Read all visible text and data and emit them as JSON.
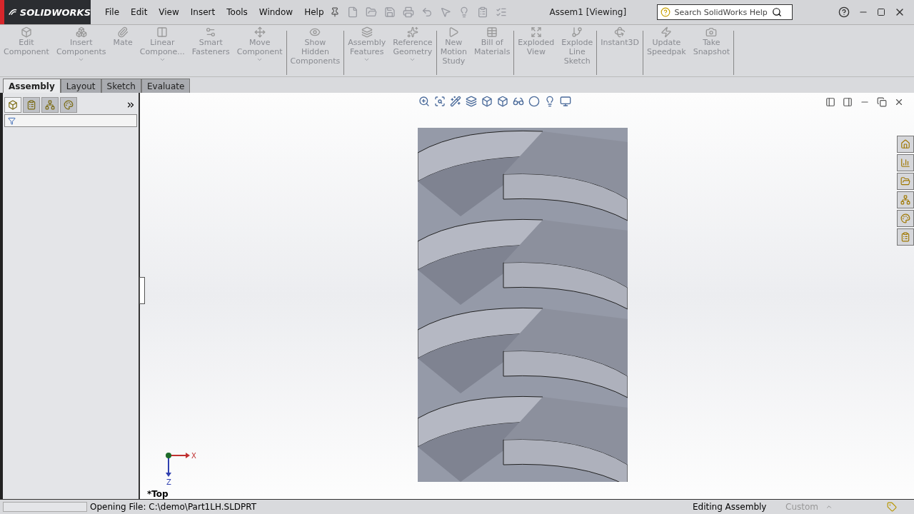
{
  "title_bar": {
    "logo": "SOLIDWORKS",
    "menus": [
      "File",
      "Edit",
      "View",
      "Insert",
      "Tools",
      "Window",
      "Help"
    ],
    "title": "Assem1 [Viewing]",
    "search": {
      "placeholder": "Search SolidWorks Help"
    }
  },
  "ribbon": {
    "groups": [
      [
        {
          "label": "Edit\nComponent",
          "dropdown": false,
          "disabled": true
        },
        {
          "label": "Insert\nComponents",
          "dropdown": true,
          "disabled": true
        },
        {
          "label": "Mate",
          "dropdown": false,
          "disabled": true
        },
        {
          "label": "Linear\nCompone...",
          "dropdown": true,
          "disabled": true
        },
        {
          "label": "Smart\nFasteners",
          "dropdown": false,
          "disabled": true
        },
        {
          "label": "Move\nComponent",
          "dropdown": true,
          "disabled": true
        }
      ],
      [
        {
          "label": "Show\nHidden\nComponents",
          "dropdown": false,
          "disabled": true
        }
      ],
      [
        {
          "label": "Assembly\nFeatures",
          "dropdown": true,
          "disabled": true
        },
        {
          "label": "Reference\nGeometry",
          "dropdown": true,
          "disabled": true
        }
      ],
      [
        {
          "label": "New\nMotion\nStudy",
          "dropdown": false,
          "disabled": true
        },
        {
          "label": "Bill of\nMaterials",
          "dropdown": false,
          "disabled": true
        }
      ],
      [
        {
          "label": "Exploded\nView",
          "dropdown": false,
          "disabled": true
        },
        {
          "label": "Explode\nLine\nSketch",
          "dropdown": false,
          "disabled": true
        }
      ],
      [
        {
          "label": "Instant3D",
          "dropdown": false,
          "disabled": true
        }
      ],
      [
        {
          "label": "Update\nSpeedpak",
          "dropdown": false,
          "disabled": true
        },
        {
          "label": "Take\nSnapshot",
          "dropdown": false,
          "disabled": true
        }
      ]
    ]
  },
  "tabs": [
    {
      "label": "Assembly",
      "selected": true
    },
    {
      "label": "Layout",
      "selected": false
    },
    {
      "label": "Sketch",
      "selected": false
    },
    {
      "label": "Evaluate",
      "selected": false
    }
  ],
  "manager_tabs": [
    {
      "selected": true
    },
    {
      "selected": false
    },
    {
      "selected": false
    },
    {
      "selected": false
    }
  ],
  "viewport": {
    "triad": {
      "x_label": "X",
      "z_label": "Z"
    },
    "view_name": "*Top"
  },
  "status_bar": {
    "message": "Opening File: C:\\demo\\Part1LH.SLDPRT",
    "mode": "Editing Assembly",
    "units": "Custom"
  }
}
